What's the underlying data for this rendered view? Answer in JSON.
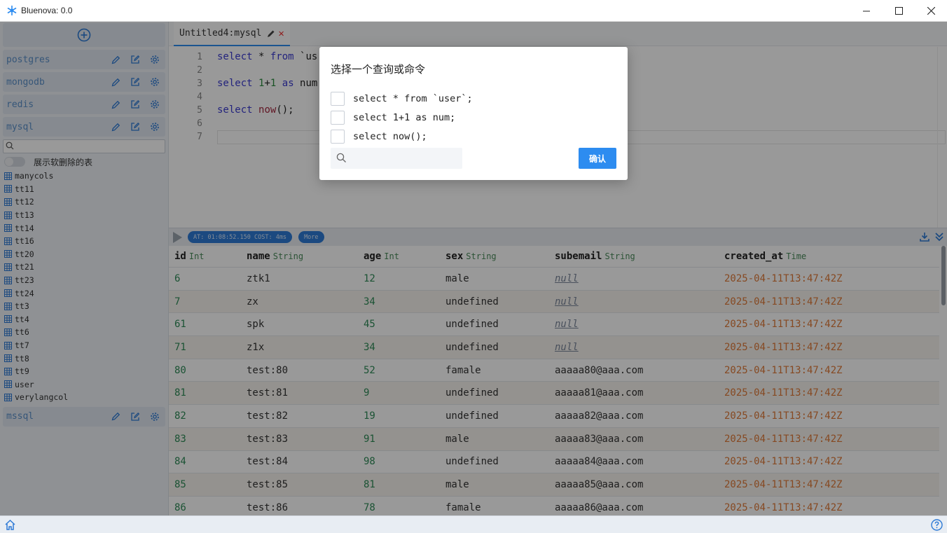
{
  "window": {
    "title": "Bluenova: 0.0"
  },
  "sidebar": {
    "connections_top": [
      {
        "name": "postgres"
      },
      {
        "name": "mongodb"
      },
      {
        "name": "redis"
      },
      {
        "name": "mysql"
      }
    ],
    "search_placeholder": "",
    "toggle_label": "展示软删除的表",
    "tables": [
      "manycols",
      "tt11",
      "tt12",
      "tt13",
      "tt14",
      "tt16",
      "tt20",
      "tt21",
      "tt23",
      "tt24",
      "tt3",
      "tt4",
      "tt6",
      "tt7",
      "tt8",
      "tt9",
      "user",
      "verylangcol"
    ],
    "connections_bottom": [
      {
        "name": "mssql"
      }
    ]
  },
  "editor": {
    "tab_title": "Untitled4:mysql",
    "line_numbers": [
      "1",
      "2",
      "3",
      "4",
      "5",
      "6",
      "7"
    ]
  },
  "results": {
    "status_pill": "AT: 01:08:52.150 COST: 4ms",
    "more_label": "More",
    "columns": [
      {
        "name": "id",
        "type": "Int"
      },
      {
        "name": "name",
        "type": "String"
      },
      {
        "name": "age",
        "type": "Int"
      },
      {
        "name": "sex",
        "type": "String"
      },
      {
        "name": "subemail",
        "type": "String"
      },
      {
        "name": "created_at",
        "type": "Time"
      }
    ],
    "rows": [
      [
        "6",
        "ztk1",
        "12",
        "male",
        "null",
        "2025-04-11T13:47:42Z"
      ],
      [
        "7",
        "zx",
        "34",
        "undefined",
        "null",
        "2025-04-11T13:47:42Z"
      ],
      [
        "61",
        "spk",
        "45",
        "undefined",
        "null",
        "2025-04-11T13:47:42Z"
      ],
      [
        "71",
        "z1x",
        "34",
        "undefined",
        "null",
        "2025-04-11T13:47:42Z"
      ],
      [
        "80",
        "test:80",
        "52",
        "famale",
        "aaaaa80@aaa.com",
        "2025-04-11T13:47:42Z"
      ],
      [
        "81",
        "test:81",
        "9",
        "undefined",
        "aaaaa81@aaa.com",
        "2025-04-11T13:47:42Z"
      ],
      [
        "82",
        "test:82",
        "19",
        "undefined",
        "aaaaa82@aaa.com",
        "2025-04-11T13:47:42Z"
      ],
      [
        "83",
        "test:83",
        "91",
        "male",
        "aaaaa83@aaa.com",
        "2025-04-11T13:47:42Z"
      ],
      [
        "84",
        "test:84",
        "98",
        "undefined",
        "aaaaa84@aaa.com",
        "2025-04-11T13:47:42Z"
      ],
      [
        "85",
        "test:85",
        "81",
        "male",
        "aaaaa85@aaa.com",
        "2025-04-11T13:47:42Z"
      ],
      [
        "86",
        "test:86",
        "78",
        "famale",
        "aaaaa86@aaa.com",
        "2025-04-11T13:47:42Z"
      ]
    ]
  },
  "dialog": {
    "title": "选择一个查询或命令",
    "options": [
      "select * from `user`;",
      "select 1+1 as num;",
      "select now();"
    ],
    "search_placeholder": "",
    "confirm_label": "确认"
  },
  "colors": {
    "accent": "#2d8cf0",
    "time": "#e07b39",
    "number": "#2e8b57",
    "conn_name": "#5b8fc9"
  }
}
